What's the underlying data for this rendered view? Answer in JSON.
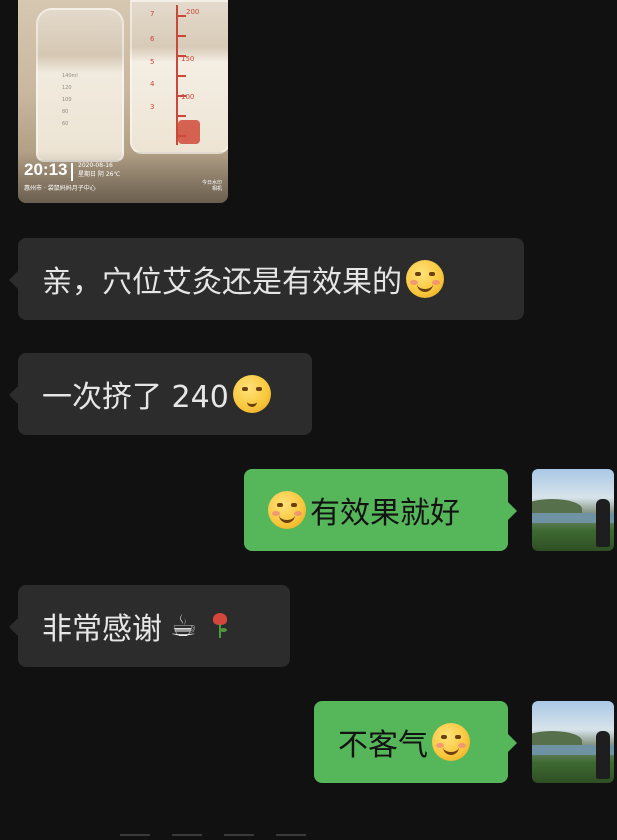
{
  "photo": {
    "time": "20:13",
    "date": "2020-08-16",
    "weekday_weather": "星期日 阴 26℃",
    "location": "惠州市 · 袋鼠妈妈月子中心",
    "brand_line1": "今日水印",
    "brand_line2": "相机",
    "scale_labels": [
      "200",
      "150",
      "100"
    ],
    "left_scale_labels": [
      "7",
      "6",
      "5",
      "4",
      "3"
    ],
    "small_labels": [
      "140ml",
      "120",
      "100",
      "80",
      "60"
    ]
  },
  "messages": [
    {
      "direction": "in",
      "text": "亲，穴位艾灸还是有效果的",
      "emoji": "hug-face"
    },
    {
      "direction": "in",
      "text": "一次挤了 240",
      "emoji": "thinking-face"
    },
    {
      "direction": "out",
      "text": "有效果就好",
      "emoji": "grin-face"
    },
    {
      "direction": "in",
      "text": "非常感谢",
      "emoji": "coffee-rose"
    },
    {
      "direction": "out",
      "text": "不客气",
      "emoji": "smile-face"
    }
  ],
  "icons": {
    "coffee": "☕"
  },
  "colors": {
    "background": "#111111",
    "incoming_bubble": "#2c2c2c",
    "outgoing_bubble": "#55b65a"
  }
}
